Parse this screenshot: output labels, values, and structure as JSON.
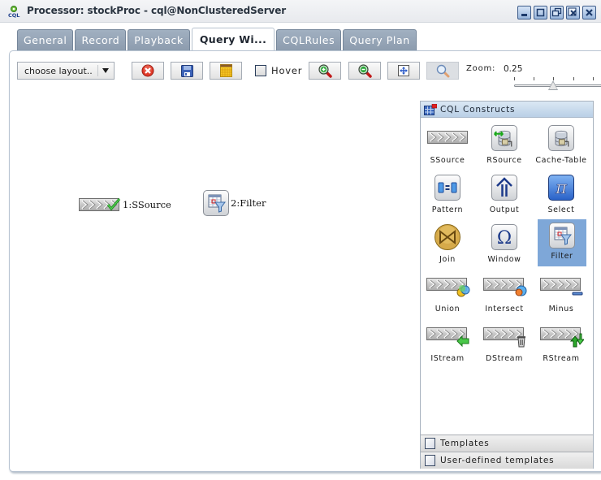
{
  "window": {
    "title": "Processor: stockProc - cql@NonClusteredServer",
    "app_icon": "cql-gear-icon",
    "controls": [
      "minimize",
      "maximize",
      "restore",
      "close-panel",
      "close"
    ]
  },
  "tabs": [
    {
      "label": "General",
      "active": false
    },
    {
      "label": "Record",
      "active": false
    },
    {
      "label": "Playback",
      "active": false
    },
    {
      "label": "Query Wi...",
      "active": true
    },
    {
      "label": "CQLRules",
      "active": false
    },
    {
      "label": "Query Plan",
      "active": false
    }
  ],
  "toolbar": {
    "layout_select": {
      "value": "choose layout.."
    },
    "buttons": [
      {
        "name": "delete",
        "icon": "red-x-circle-icon"
      },
      {
        "name": "save",
        "icon": "floppy-disk-icon"
      },
      {
        "name": "grid",
        "icon": "grid-calendar-icon"
      }
    ],
    "hover": {
      "label": "Hover",
      "checked": false
    },
    "zoom_buttons": [
      {
        "name": "zoom-in",
        "icon": "zoom-in-icon",
        "enabled": true
      },
      {
        "name": "zoom-out",
        "icon": "zoom-out-icon",
        "enabled": true
      },
      {
        "name": "fit",
        "icon": "fit-to-screen-icon",
        "enabled": true
      },
      {
        "name": "zoom-actual",
        "icon": "magnifier-icon",
        "enabled": false
      }
    ],
    "zoom_label": "Zoom:",
    "zoom_value": "0.25"
  },
  "canvas": {
    "nodes": [
      {
        "label": "1:SSource",
        "type": "ssource",
        "valid": true
      },
      {
        "label": "2:Filter",
        "type": "filter"
      }
    ]
  },
  "palette": {
    "title": "CQL Constructs",
    "items": [
      {
        "label": "SSource",
        "icon": "stream-source-icon"
      },
      {
        "label": "RSource",
        "icon": "relation-source-icon"
      },
      {
        "label": "Cache-Table",
        "icon": "cache-table-icon"
      },
      {
        "label": "Pattern",
        "icon": "pattern-icon"
      },
      {
        "label": "Output",
        "icon": "output-icon"
      },
      {
        "label": "Select",
        "icon": "select-pi-icon"
      },
      {
        "label": "Join",
        "icon": "join-bowtie-icon"
      },
      {
        "label": "Window",
        "icon": "window-omega-icon"
      },
      {
        "label": "Filter",
        "icon": "filter-funnel-icon",
        "selected": true
      },
      {
        "label": "Union",
        "icon": "union-icon"
      },
      {
        "label": "Intersect",
        "icon": "intersect-icon"
      },
      {
        "label": "Minus",
        "icon": "minus-icon"
      },
      {
        "label": "IStream",
        "icon": "istream-icon"
      },
      {
        "label": "DStream",
        "icon": "dstream-icon"
      },
      {
        "label": "RStream",
        "icon": "rstream-icon"
      }
    ],
    "sections": [
      {
        "label": "Templates"
      },
      {
        "label": "User-defined templates"
      }
    ]
  }
}
